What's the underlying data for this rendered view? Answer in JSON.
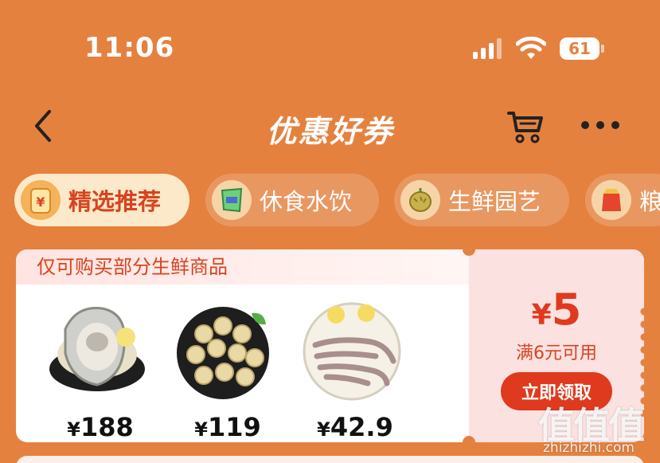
{
  "status_bar": {
    "time": "11:06",
    "battery": "61"
  },
  "nav": {
    "title": "优惠好券"
  },
  "tabs": [
    {
      "label": "精选推荐",
      "icon": "coupon-bag-icon",
      "active": true
    },
    {
      "label": "休食水饮",
      "icon": "snack-bag-icon",
      "active": false
    },
    {
      "label": "生鲜园艺",
      "icon": "durian-icon",
      "active": false
    },
    {
      "label": "粮",
      "icon": "grain-bag-icon",
      "active": false
    }
  ],
  "coupon": {
    "header": "仅可购买部分生鲜商品",
    "products": [
      {
        "name": "oyster",
        "price": "188"
      },
      {
        "name": "scallop",
        "price": "119"
      },
      {
        "name": "squid",
        "price": "42.9"
      }
    ],
    "currency": "¥",
    "amount": "5",
    "condition": "满6元可用",
    "claim_label": "立即领取"
  },
  "watermark": {
    "logo": "值值值",
    "url": "zhizhizhi.com"
  },
  "colors": {
    "background": "#E5813F",
    "accent": "#E03A1E",
    "tab_active_bg": "#FCE9C9"
  }
}
